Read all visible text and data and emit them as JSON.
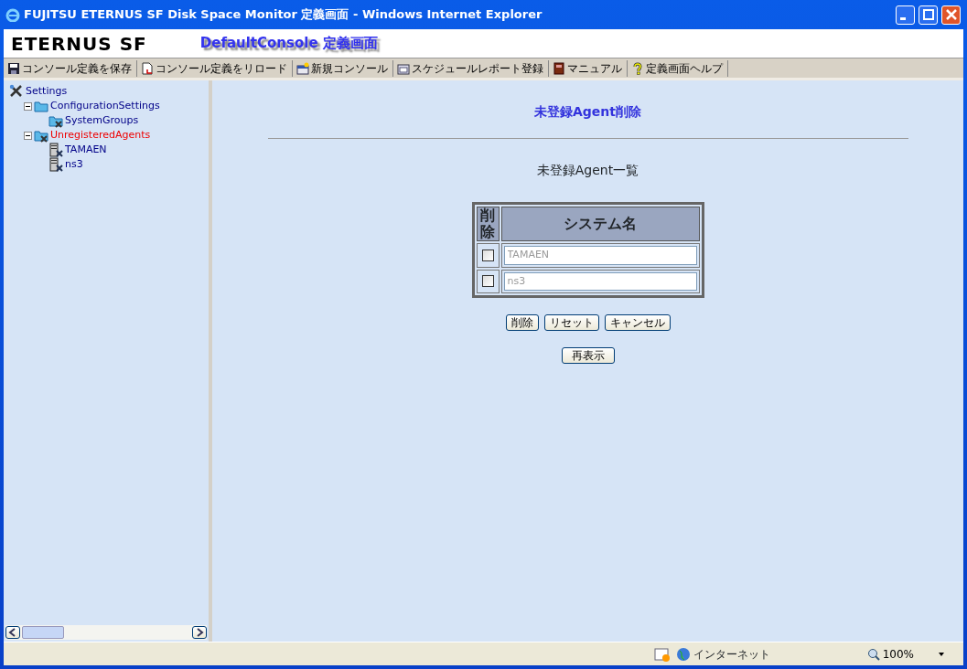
{
  "window": {
    "title": "FUJITSU ETERNUS SF Disk Space Monitor 定義画面 - Windows Internet Explorer"
  },
  "header": {
    "logo": "ETERNUS SF",
    "title": "DefaultConsole 定義画面"
  },
  "toolbar": [
    {
      "kind": "save",
      "label": "コンソール定義を保存"
    },
    {
      "kind": "reload",
      "label": "コンソール定義をリロード"
    },
    {
      "kind": "new",
      "label": "新規コンソール"
    },
    {
      "kind": "schedule",
      "label": "スケジュールレポート登録"
    },
    {
      "kind": "manual",
      "label": "マニュアル"
    },
    {
      "kind": "help",
      "label": "定義画面ヘルプ"
    }
  ],
  "tree": [
    {
      "kind": "tools",
      "label": "Settings",
      "selected": false,
      "children": [
        {
          "kind": "folder",
          "label": "ConfigurationSettings",
          "selected": false,
          "expanded": true,
          "children": [
            {
              "kind": "agent-folder",
              "label": "SystemGroups",
              "selected": false
            }
          ]
        },
        {
          "kind": "agent-folder",
          "label": "UnregisteredAgents",
          "selected": true,
          "expanded": true,
          "children": [
            {
              "kind": "server",
              "label": "TAMAEN",
              "selected": false
            },
            {
              "kind": "server",
              "label": "ns3",
              "selected": false
            }
          ]
        }
      ]
    }
  ],
  "main": {
    "heading": "未登録Agent削除",
    "subheading": "未登録Agent一覧",
    "table": {
      "columns": [
        "削除",
        "システム名"
      ],
      "rows": [
        {
          "checked": false,
          "name": "TAMAEN"
        },
        {
          "checked": false,
          "name": "ns3"
        }
      ]
    },
    "buttons": [
      "削除",
      "リセット",
      "キャンセル"
    ],
    "refresh_button": "再表示"
  },
  "status_bar": {
    "zone": "インターネット",
    "zoom": "100%"
  }
}
